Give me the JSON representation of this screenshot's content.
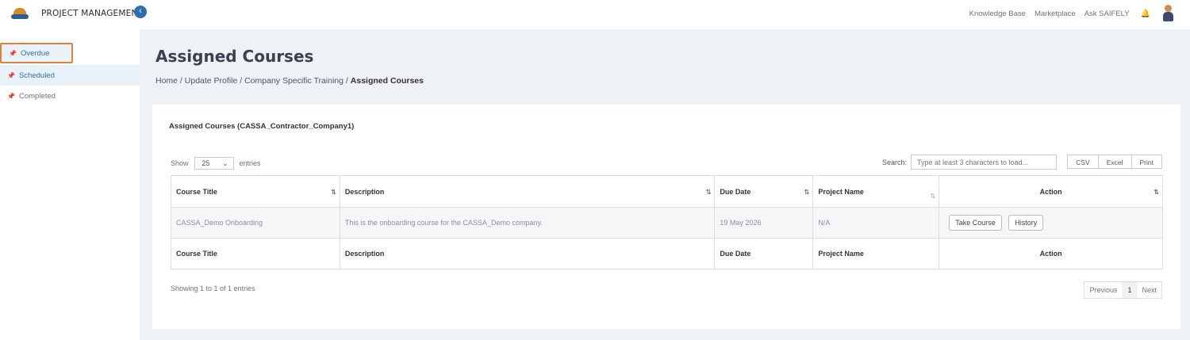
{
  "header": {
    "app_name": "PROJECT MANAGEMENT",
    "links": [
      "Knowledge Base",
      "Marketplace",
      "Ask SAIFELY"
    ]
  },
  "sidebar": {
    "items": [
      {
        "label": "Overdue"
      },
      {
        "label": "Scheduled"
      },
      {
        "label": "Completed"
      }
    ]
  },
  "page": {
    "title": "Assigned Courses",
    "breadcrumb": [
      "Home",
      "Update Profile",
      "Company Specific Training",
      "Assigned Courses"
    ]
  },
  "card": {
    "title": "Assigned Courses (CASSA_Contractor_Company1)",
    "show_label": "Show",
    "entries_value": "25",
    "entries_label": "entries",
    "search_label": "Search:",
    "search_placeholder": "Type at least 3 characters to load...",
    "export_buttons": [
      "CSV",
      "Excel",
      "Print"
    ]
  },
  "table": {
    "columns": [
      "Course Title",
      "Description",
      "Due Date",
      "Project Name",
      "Action"
    ],
    "rows": [
      {
        "course_title": "CASSA_Demo Onboarding",
        "description": "This is the onboarding course for the CASSA_Demo company.",
        "due_date": "19 May 2026",
        "project_name": "N/A",
        "actions": [
          "Take Course",
          "History"
        ]
      }
    ],
    "footer": [
      "Course Title",
      "Description",
      "Due Date",
      "Project Name",
      "Action"
    ]
  },
  "pagination": {
    "info": "Showing 1 to 1 of 1 entries",
    "previous": "Previous",
    "page": "1",
    "next": "Next"
  },
  "colors": {
    "accent": "#2f6fb0",
    "highlight_border": "#d9823b",
    "content_bg": "#eef1f5"
  }
}
